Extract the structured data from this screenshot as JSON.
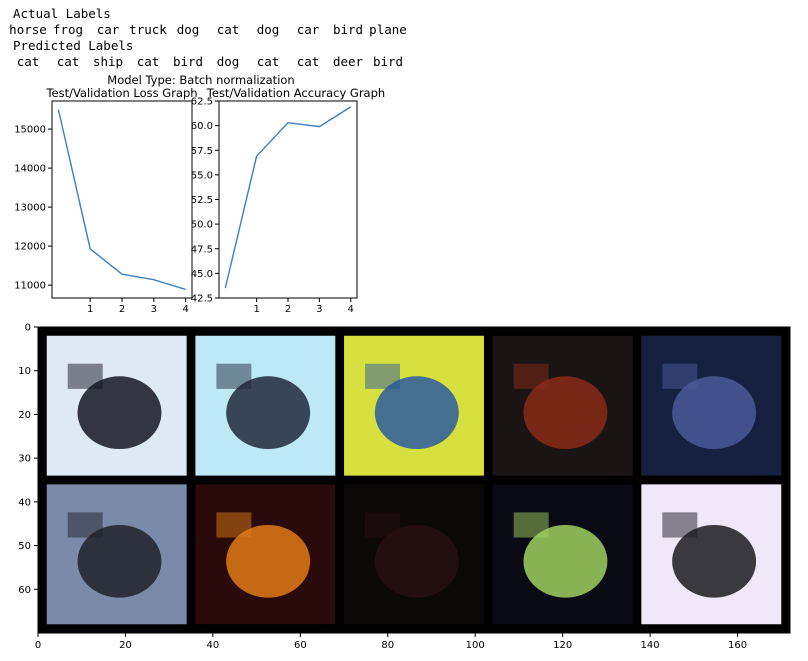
{
  "text_output": {
    "actual_heading": "Actual Labels",
    "actual_labels": [
      "horse",
      "frog",
      "car",
      "truck",
      "dog",
      "cat",
      "dog",
      "car",
      "bird",
      "plane"
    ],
    "predicted_heading": "Predicted Labels",
    "predicted_labels": [
      "cat",
      "cat",
      "ship",
      "cat",
      "bird",
      "dog",
      "cat",
      "cat",
      "deer",
      "bird"
    ]
  },
  "figure": {
    "suptitle": "Model Type: Batch normalization"
  },
  "chart_data": [
    {
      "type": "line",
      "title": "Test/Validation Loss Graph",
      "xlabel": "",
      "ylabel": "",
      "x": [
        0,
        1,
        2,
        3,
        4
      ],
      "values": [
        15500,
        11930,
        11280,
        11140,
        10890
      ],
      "xticks": [
        "1",
        "2",
        "3",
        "4"
      ],
      "yticks": [
        "11000",
        "12000",
        "13000",
        "14000",
        "15000"
      ],
      "xlim": [
        -0.2,
        4.2
      ],
      "ylim": [
        10670,
        15720
      ],
      "line_color": "#3b82bd"
    },
    {
      "type": "line",
      "title": "Test/Validation Accuracy Graph",
      "xlabel": "",
      "ylabel": "",
      "x": [
        0,
        1,
        2,
        3,
        4
      ],
      "values": [
        43.5,
        56.9,
        60.3,
        59.9,
        61.9
      ],
      "xticks": [
        "1",
        "2",
        "3",
        "4"
      ],
      "yticks": [
        "42.5",
        "45.0",
        "47.5",
        "50.0",
        "52.5",
        "55.0",
        "57.5",
        "60.0",
        "62.5"
      ],
      "xlim": [
        -0.2,
        4.2
      ],
      "ylim": [
        42.5,
        62.5
      ],
      "line_color": "#3b82bd"
    },
    {
      "type": "image_grid",
      "grid": [
        2,
        5
      ],
      "xticks": [
        "0",
        "20",
        "40",
        "60",
        "80",
        "100",
        "120",
        "140",
        "160"
      ],
      "yticks": [
        "0",
        "10",
        "20",
        "30",
        "40",
        "50",
        "60"
      ],
      "xlim": [
        0,
        172
      ],
      "ylim": [
        70,
        0
      ],
      "tiles": [
        {
          "label": "horse",
          "bg": "#dfe9f6",
          "accent": "#151520"
        },
        {
          "label": "frog",
          "bg": "#bfe8f6",
          "accent": "#20283a"
        },
        {
          "label": "car",
          "bg": "#d8e040",
          "accent": "#2a5aa0"
        },
        {
          "label": "truck",
          "bg": "#1a1414",
          "accent": "#8a2a18"
        },
        {
          "label": "dog",
          "bg": "#162040",
          "accent": "#4a5a9a"
        },
        {
          "label": "cat",
          "bg": "#7a8aa8",
          "accent": "#20202a"
        },
        {
          "label": "dog",
          "bg": "#2a0a0a",
          "accent": "#e07a18"
        },
        {
          "label": "car",
          "bg": "#0c0808",
          "accent": "#281010"
        },
        {
          "label": "bird",
          "bg": "#0a0a14",
          "accent": "#a0d060"
        },
        {
          "label": "plane",
          "bg": "#f0e8f8",
          "accent": "#1a1a20"
        }
      ]
    }
  ]
}
